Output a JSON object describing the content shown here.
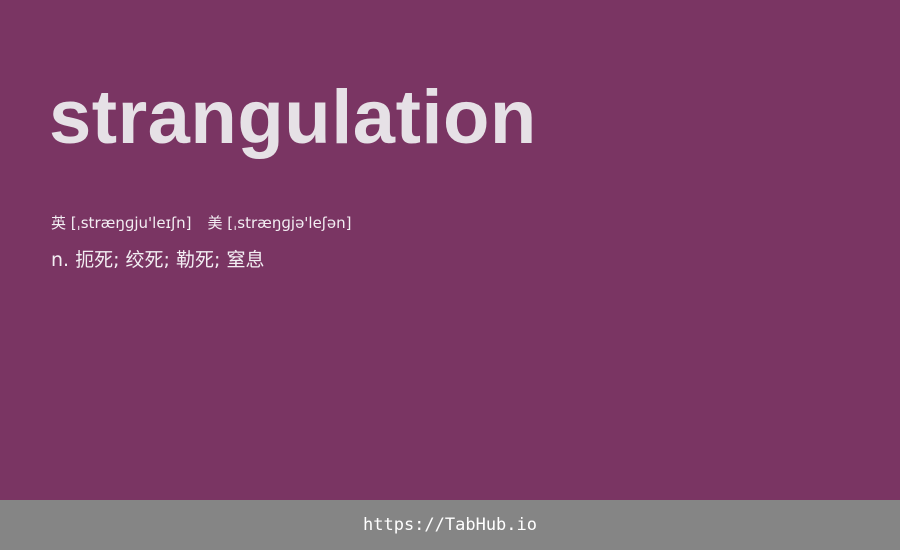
{
  "entry": {
    "word": "strangulation",
    "phonetics": {
      "uk": "英 [ˌstræŋɡju'leɪʃn]",
      "us": "美 [ˌstræŋɡjə'leʃən]"
    },
    "definition": "n. 扼死; 绞死; 勒死; 窒息"
  },
  "footer": {
    "link": "https://TabHub.io"
  },
  "colors": {
    "background": "#7a3563",
    "word_text": "#e6e1e6",
    "footer_bar": "#858585"
  }
}
